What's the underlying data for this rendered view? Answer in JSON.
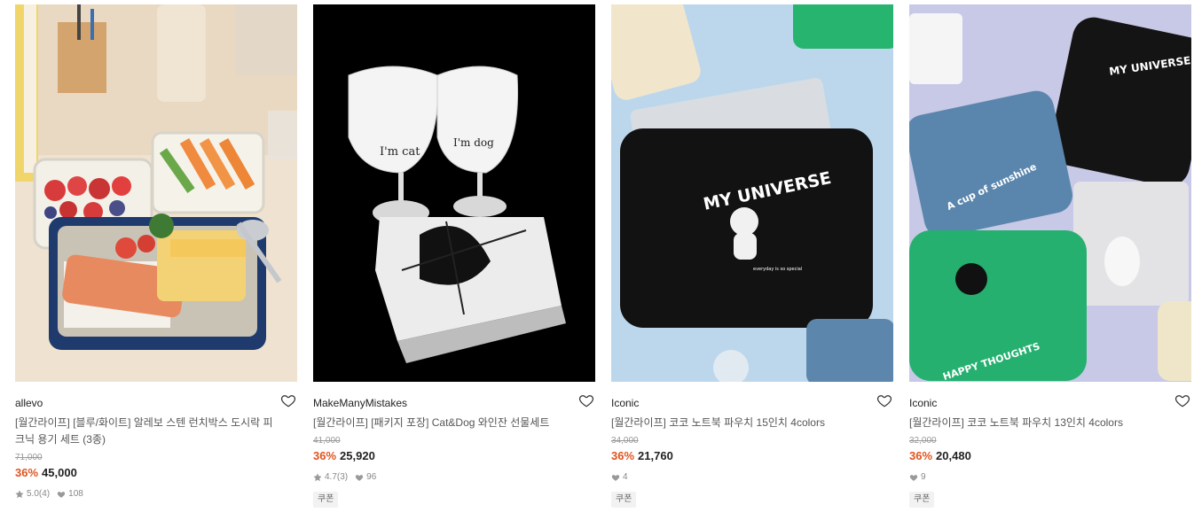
{
  "colors": {
    "discount": "#e0551f",
    "text": "#222222",
    "muted": "#999999"
  },
  "products": [
    {
      "brand": "allevo",
      "title": "[월간라이프] [블루/화이트] 알레보 스텐 런치박스 도시락 피크닉 용기 세트 (3종)",
      "original_price": "71,000",
      "discount": "36%",
      "price": "45,000",
      "rating": "5.0",
      "review_count": "(4)",
      "likes": "108",
      "coupon": ""
    },
    {
      "brand": "MakeManyMistakes",
      "title": "[월간라이프] [패키지 포장] Cat&Dog 와인잔 선물세트",
      "original_price": "41,000",
      "discount": "36%",
      "price": "25,920",
      "rating": "4.7",
      "review_count": "(3)",
      "likes": "96",
      "coupon": "쿠폰"
    },
    {
      "brand": "Iconic",
      "title": "[월간라이프] 코코 노트북 파우치 15인치 4colors",
      "original_price": "34,000",
      "discount": "36%",
      "price": "21,760",
      "likes": "4",
      "coupon": "쿠폰"
    },
    {
      "brand": "Iconic",
      "title": "[월간라이프] 코코 노트북 파우치 13인치 4colors",
      "original_price": "32,000",
      "discount": "36%",
      "price": "20,480",
      "likes": "9",
      "coupon": "쿠폰"
    }
  ],
  "image_text": {
    "glass_left": "I'm cat",
    "glass_right": "I'm dog",
    "pouch_15": "MY UNIVERSE",
    "pouch_15_small": "everyday is so special",
    "pouch_13_black": "MY UNIVERSE",
    "pouch_13_blue": "A cup of sunshine",
    "pouch_13_green": "HAPPY THOUGHTS"
  },
  "icons": {
    "like": "heart-outline-icon",
    "rating": "star-icon",
    "likes": "heart-filled-icon"
  }
}
